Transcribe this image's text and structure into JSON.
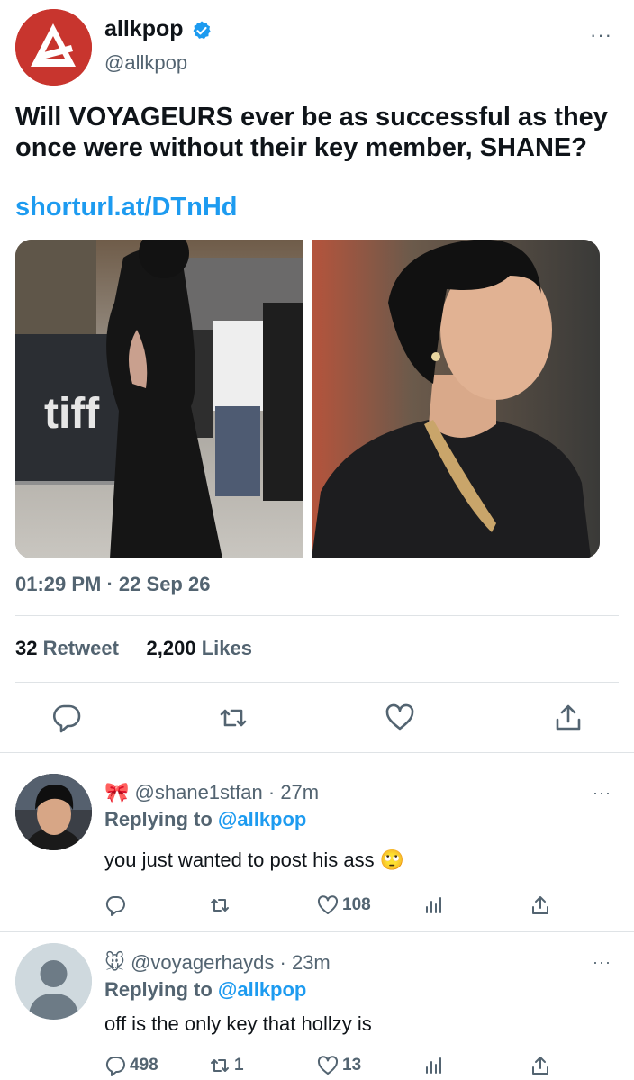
{
  "tweet": {
    "author_name": "allkpop",
    "author_handle": "@allkpop",
    "text": "Will VOYAGEURS ever be as successful as they once were without their key member, SHANE?",
    "link": "shorturl.at/DTnHd",
    "timestamp": "01:29 PM · 22 Sep 26",
    "retweet_count": "32",
    "retweet_label": "Retweet",
    "like_count": "2,200",
    "like_label": "Likes",
    "more": "···",
    "photo_left_sign": "tiff"
  },
  "actions": [
    "comment-icon",
    "retweet-icon",
    "heart-icon",
    "share-icon"
  ],
  "replies": [
    {
      "emoji": "🎀",
      "handle": "@shane1stfan",
      "time": "· 27m",
      "replying_label": "Replying to",
      "replying_to": "@allkpop",
      "text": "you just wanted to post his ass 🙄",
      "reply_count": "",
      "retweet_count": "",
      "like_count": "108"
    },
    {
      "emoji": "🐭",
      "handle": "@voyagerhayds",
      "time": "· 23m",
      "replying_label": "Replying to",
      "replying_to": "@allkpop",
      "text": "off is the only key that hollzy is",
      "reply_count": "498",
      "retweet_count": "1",
      "like_count": "13"
    }
  ],
  "colors": {
    "accent": "#1d9bf0",
    "muted": "#536471",
    "brand": "#c8352e"
  }
}
